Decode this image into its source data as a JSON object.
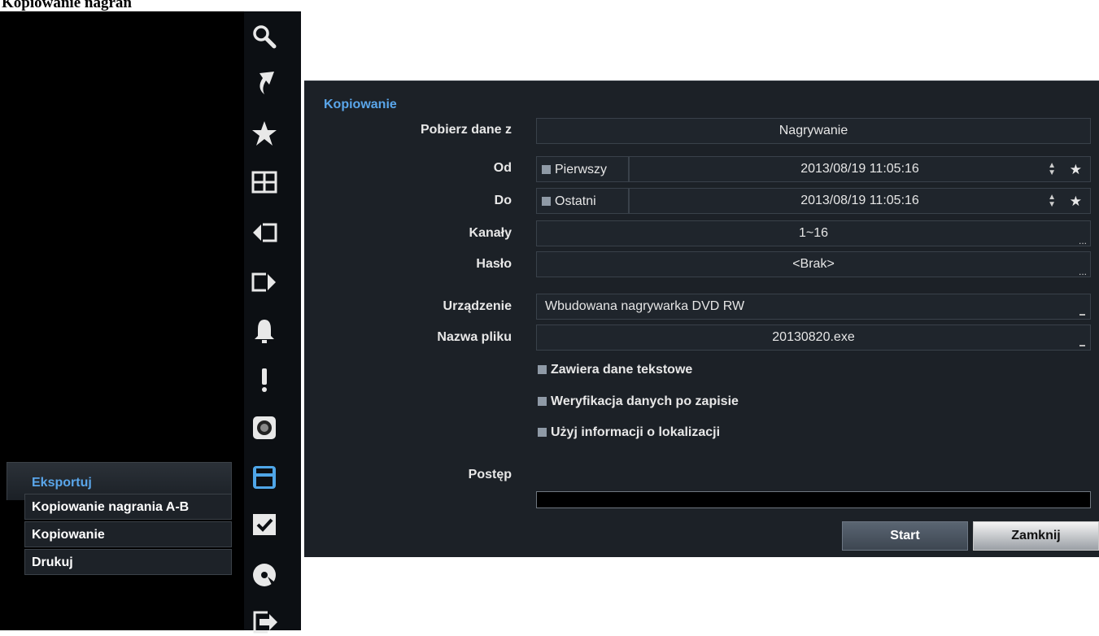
{
  "page_heading": "Kopiowanie nagrań",
  "menu": {
    "header": "Eksportuj",
    "items": [
      "Kopiowanie nagrania A-B",
      "Kopiowanie",
      "Drukuj"
    ]
  },
  "icons": [
    "search-icon",
    "arrow-icon",
    "star-icon",
    "grid-icon",
    "prev-icon",
    "next-icon",
    "bell-icon",
    "alert-icon",
    "camera-icon",
    "save-icon",
    "check-icon",
    "disc-icon",
    "exit-icon"
  ],
  "dialog": {
    "title": "Kopiowanie",
    "source": {
      "label": "Pobierz dane z",
      "value": "Nagrywanie"
    },
    "from": {
      "label": "Od",
      "check_label": "Pierwszy",
      "value": "2013/08/19  11:05:16"
    },
    "to": {
      "label": "Do",
      "check_label": "Ostatni",
      "value": "2013/08/19  11:05:16"
    },
    "channels": {
      "label": "Kanały",
      "value": "1~16"
    },
    "password": {
      "label": "Hasło",
      "value": "<Brak>"
    },
    "device": {
      "label": "Urządzenie",
      "value": "Wbudowana nagrywarka DVD RW"
    },
    "filename": {
      "label": "Nazwa pliku",
      "value": "20130820.exe"
    },
    "options": [
      "Zawiera dane tekstowe",
      "Weryfikacja danych po zapisie",
      "Użyj informacji o lokalizacji"
    ],
    "progress_label": "Postęp",
    "progress": 0,
    "start_label": "Start",
    "close_label": "Zamknij",
    "ellipsis": "..."
  }
}
